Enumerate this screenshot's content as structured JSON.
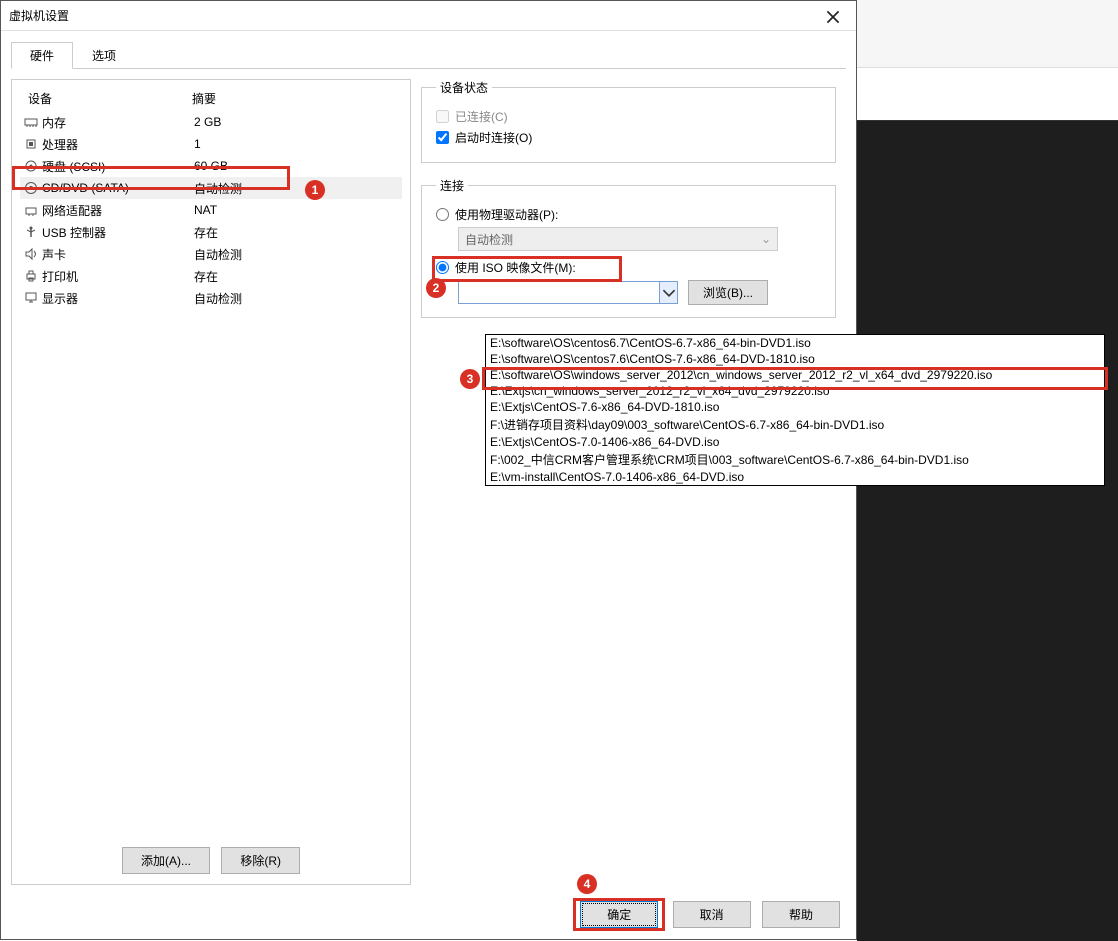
{
  "window": {
    "title": "虚拟机设置"
  },
  "tabs": {
    "hardware": "硬件",
    "options": "选项"
  },
  "columns": {
    "device": "设备",
    "summary": "摘要"
  },
  "devices": [
    {
      "icon": "ram",
      "label": "内存",
      "summary": "2 GB"
    },
    {
      "icon": "cpu",
      "label": "处理器",
      "summary": "1"
    },
    {
      "icon": "disk",
      "label": "硬盘 (SCSI)",
      "summary": "60 GB"
    },
    {
      "icon": "cd",
      "label": "CD/DVD (SATA)",
      "summary": "自动检测"
    },
    {
      "icon": "net",
      "label": "网络适配器",
      "summary": "NAT"
    },
    {
      "icon": "usb",
      "label": "USB 控制器",
      "summary": "存在"
    },
    {
      "icon": "sound",
      "label": "声卡",
      "summary": "自动检测"
    },
    {
      "icon": "printer",
      "label": "打印机",
      "summary": "存在"
    },
    {
      "icon": "display",
      "label": "显示器",
      "summary": "自动检测"
    }
  ],
  "leftButtons": {
    "add": "添加(A)...",
    "remove": "移除(R)"
  },
  "deviceStatus": {
    "legend": "设备状态",
    "connected": "已连接(C)",
    "connectAtPowerOn": "启动时连接(O)"
  },
  "connection": {
    "legend": "连接",
    "usePhysical": "使用物理驱动器(P):",
    "autoDetect": "自动检测",
    "useIso": "使用 ISO 映像文件(M):",
    "browse": "浏览(B)..."
  },
  "isoPath": "",
  "dropdown": [
    "E:\\software\\OS\\centos6.7\\CentOS-6.7-x86_64-bin-DVD1.iso",
    "E:\\software\\OS\\centos7.6\\CentOS-7.6-x86_64-DVD-1810.iso",
    "E:\\software\\OS\\windows_server_2012\\cn_windows_server_2012_r2_vl_x64_dvd_2979220.iso",
    "E:\\Extjs\\cn_windows_server_2012_r2_vl_x64_dvd_2979220.iso",
    "E:\\Extjs\\CentOS-7.6-x86_64-DVD-1810.iso",
    "F:\\进销存项目资料\\day09\\003_software\\CentOS-6.7-x86_64-bin-DVD1.iso",
    "E:\\Extjs\\CentOS-7.0-1406-x86_64-DVD.iso",
    "F:\\002_中信CRM客户管理系统\\CRM项目\\003_software\\CentOS-6.7-x86_64-bin-DVD1.iso",
    "E:\\vm-install\\CentOS-7.0-1406-x86_64-DVD.iso"
  ],
  "bottomButtons": {
    "ok": "确定",
    "cancel": "取消",
    "help": "帮助"
  },
  "badges": [
    "1",
    "2",
    "3",
    "4"
  ]
}
